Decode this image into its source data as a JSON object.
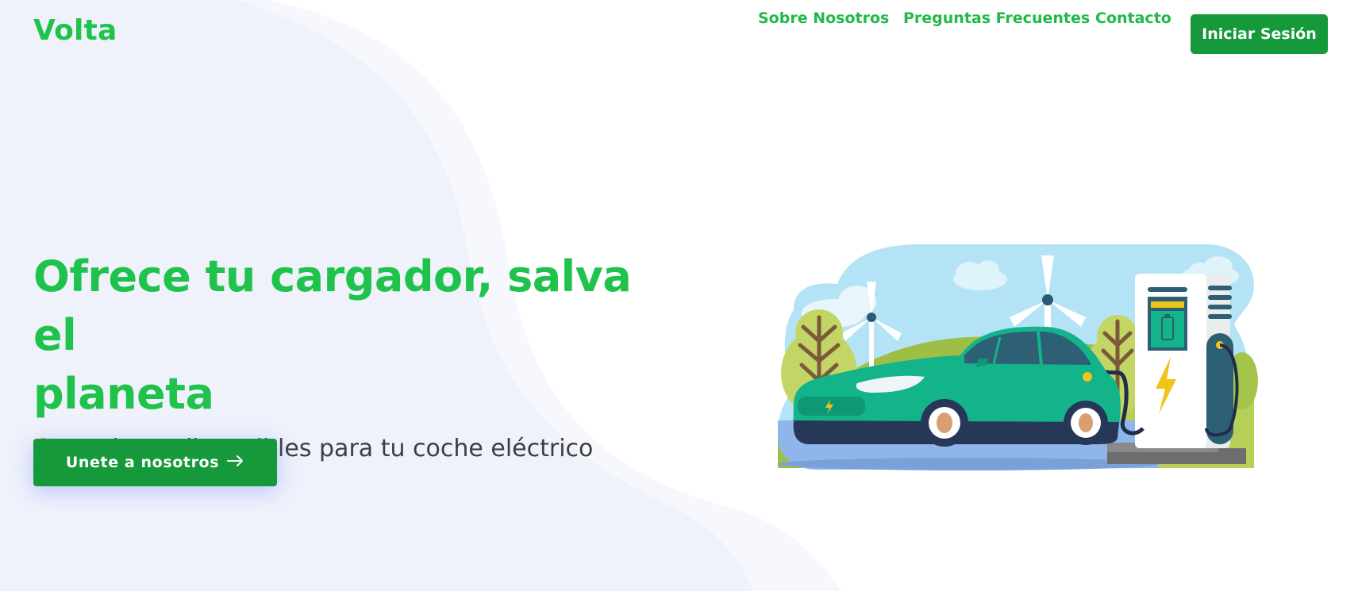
{
  "brand": {
    "name": "Volta",
    "color": "#1fc24a"
  },
  "nav": {
    "links": [
      "Sobre Nosotros",
      "Preguntas Frecuentes",
      "Contacto"
    ],
    "login_label": "Iniciar Sesión"
  },
  "hero": {
    "headline_line1": "Ofrece tu cargador, salva el",
    "headline_line2": "planeta",
    "subheadline": "Cargadores disponibles para tu coche eléctrico",
    "cta_label": "Unete a nosotros",
    "cta_icon": "arrow-right-icon"
  },
  "colors": {
    "accent": "#1fc24a",
    "button": "#15993a",
    "background_shape": "#eff2fb"
  },
  "illustration": {
    "subject": "electric-car-charging-illustration",
    "icons": [
      "wind-turbine-icon",
      "tree-icon",
      "cloud-icon",
      "charging-station-icon",
      "lightning-bolt-icon",
      "battery-icon"
    ]
  }
}
